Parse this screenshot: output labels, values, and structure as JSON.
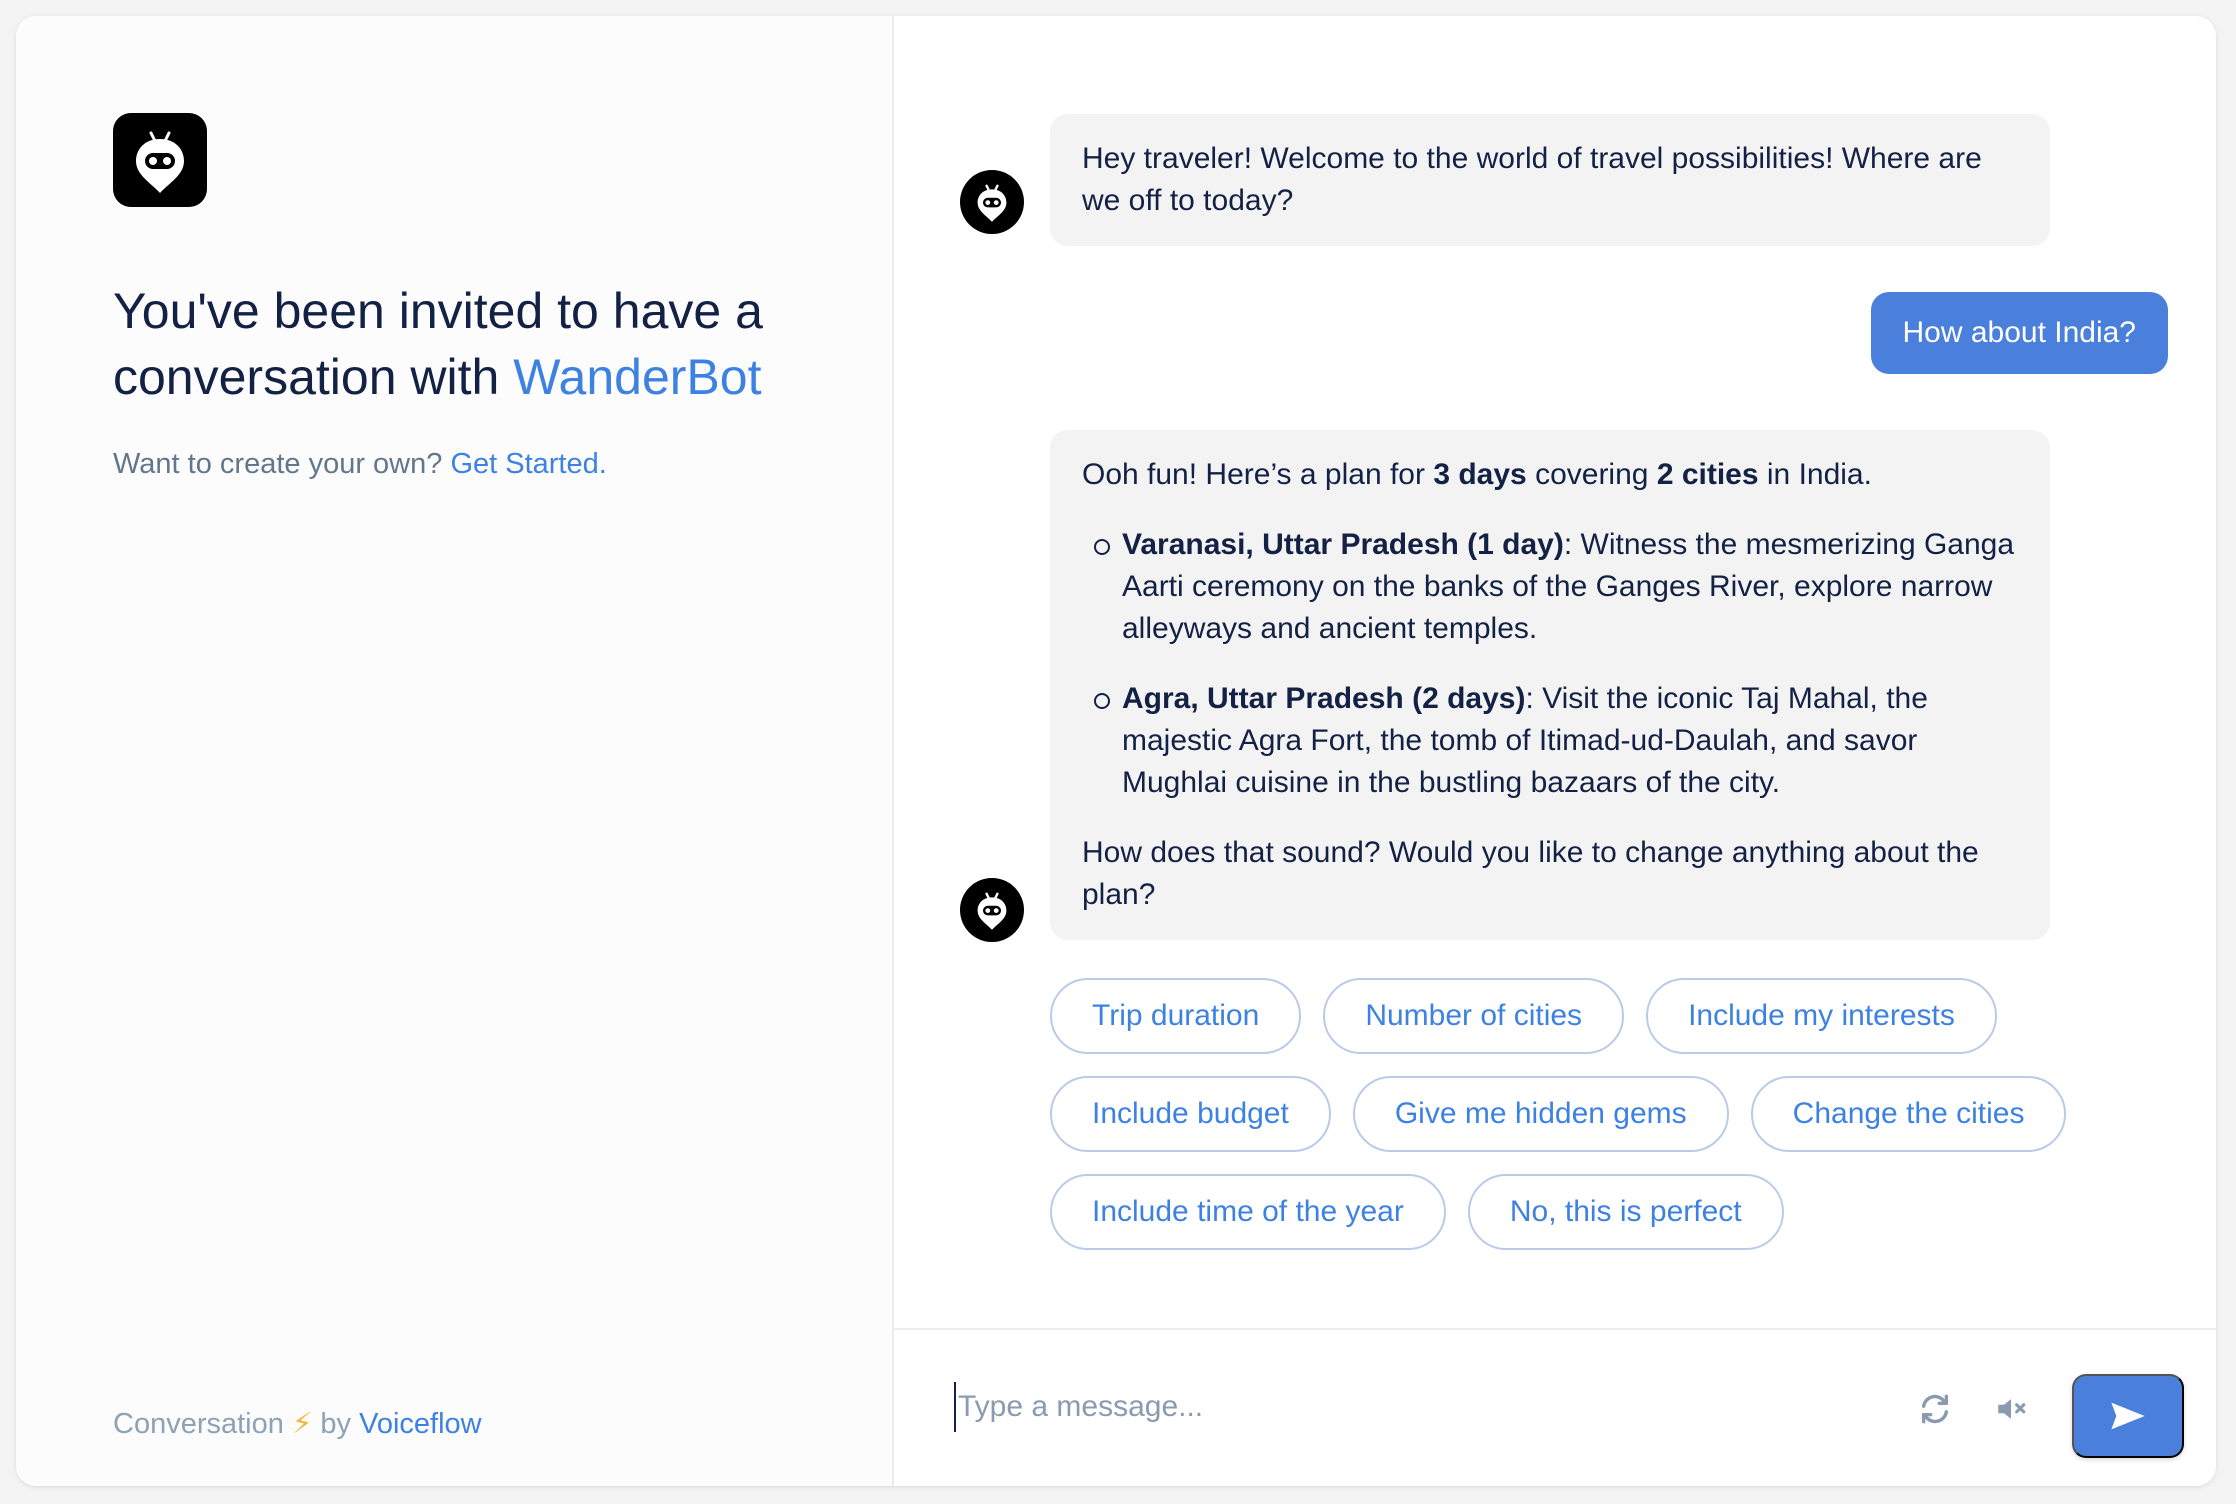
{
  "sidebar": {
    "headline_prefix": "You've been invited to have a conversation with",
    "bot_name": "WanderBot",
    "sub_prefix": "Want to create your own?",
    "sub_link": "Get Started.",
    "footer_prefix": "Conversation",
    "footer_bolt": "⚡",
    "footer_by": "by",
    "footer_brand": "Voiceflow",
    "logo_icon": "robot-pin-icon"
  },
  "messages": {
    "bot_greeting": "Hey traveler! Welcome to the world of travel possibilities! Where are we off to today?",
    "user_reply": "How about India?",
    "plan": {
      "intro_a": "Ooh fun! Here’s a plan for ",
      "intro_days": "3 days",
      "intro_b": " covering ",
      "intro_cities": "2 cities",
      "intro_c": " in India.",
      "items": [
        {
          "title": "Varanasi, Uttar Pradesh (1 day)",
          "text": ": Witness the mesmerizing Ganga Aarti ceremony on the banks of the Ganges River, explore narrow alleyways and ancient temples."
        },
        {
          "title": "Agra, Uttar Pradesh (2 days)",
          "text": ": Visit the iconic Taj Mahal, the majestic Agra Fort, the tomb of Itimad-ud-Daulah, and savor Mughlai cuisine in the bustling bazaars of the city."
        }
      ],
      "outro": "How does that sound? Would you like to change anything about the plan?"
    }
  },
  "chips": {
    "row1": [
      "Trip duration",
      "Number of cities",
      "Include my interests"
    ],
    "row2": [
      "Include budget",
      "Give me hidden gems",
      "Change the cities"
    ],
    "row3": [
      "Include time of the year",
      "No, this is perfect"
    ]
  },
  "composer": {
    "placeholder": "Type a message...",
    "restart_icon": "restart-icon",
    "mute_icon": "speaker-muted-icon",
    "send_icon": "send-icon"
  },
  "colors": {
    "accent": "#3d82e2",
    "user_bubble": "#4a7fdc",
    "bot_bubble": "#f3f3f4",
    "text": "#132144",
    "muted": "#62778c"
  }
}
